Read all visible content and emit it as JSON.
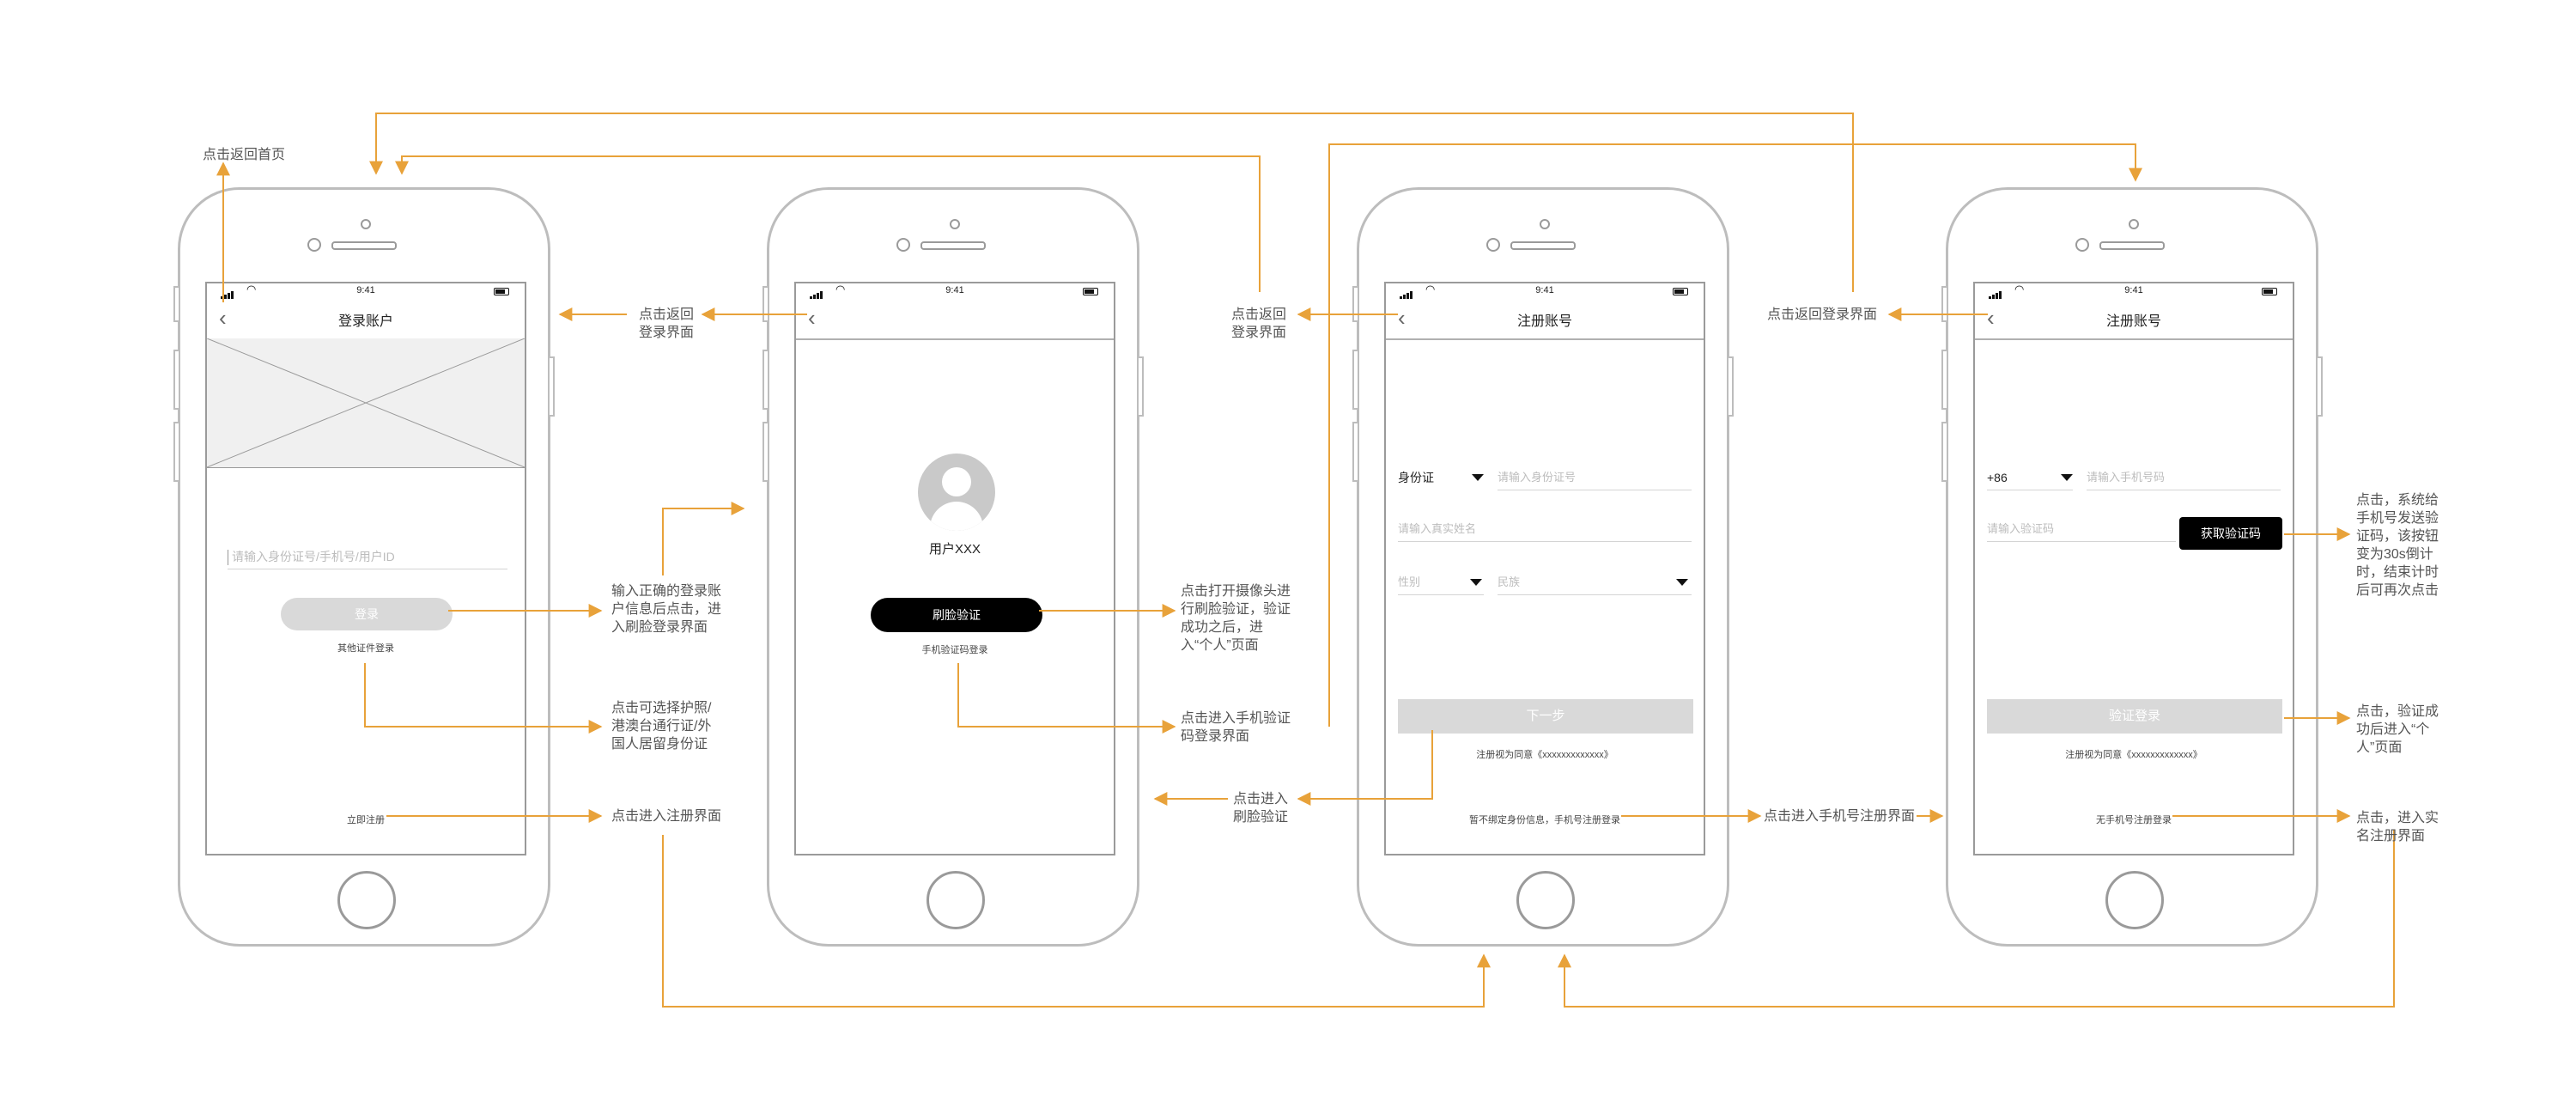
{
  "status_time": "9:41",
  "screens": [
    {
      "title": "登录账户",
      "input_placeholder": "请输入身份证号/手机号/用户ID",
      "login_button": "登录",
      "other_login": "其他证件登录",
      "register_now": "立即注册"
    },
    {
      "username": "用户XXX",
      "face_button": "刷脸验证",
      "sms_login": "手机验证码登录"
    },
    {
      "title": "注册账号",
      "id_type": "身份证",
      "id_placeholder": "请输入身份证号",
      "name_placeholder": "请输入真实姓名",
      "gender_placeholder": "性别",
      "ethnicity_placeholder": "民族",
      "next_button": "下一步",
      "agree_text": "注册视为同意《xxxxxxxxxxxxx》",
      "phone_register_link": "暂不绑定身份信息，手机号注册登录"
    },
    {
      "title": "注册账号",
      "country_code": "+86",
      "phone_placeholder": "请输入手机号码",
      "code_placeholder": "请输入验证码",
      "get_code_button": "获取验证码",
      "verify_login_button": "验证登录",
      "agree_text": "注册视为同意《xxxxxxxxxxxxx》",
      "no_phone_link": "无手机号注册登录"
    }
  ],
  "annotations": {
    "back_home": "点击返回首页",
    "back_login_1": [
      "点击返回",
      "登录界面"
    ],
    "back_login_2": [
      "点击返回",
      "登录界面"
    ],
    "back_login_3": "点击返回登录界面",
    "login_note": [
      "输入正确的登录账",
      "户信息后点击，进",
      "入刷脸登录界面"
    ],
    "other_id_note": [
      "点击可选择护照/",
      "港澳台通行证/外",
      "国人居留身份证"
    ],
    "register_note": "点击进入注册界面",
    "face_note": [
      "点击打开摄像头进",
      "行刷脸验证，验证",
      "成功之后，进",
      "入“个人”页面"
    ],
    "sms_note": [
      "点击进入手机验证",
      "码登录界面"
    ],
    "face_verify_note": [
      "点击进入",
      "刷脸验证"
    ],
    "phone_register_note": "点击进入手机号注册界面",
    "get_code_note": [
      "点击，系统给",
      "手机号发送验",
      "证码，该按钮",
      "变为30s倒计",
      "时，结束计时",
      "后可再次点击"
    ],
    "verify_note": [
      "点击，验证成",
      "功后进入“个",
      "人”页面"
    ],
    "real_name_note": [
      "点击，进入实",
      "名注册界面"
    ]
  },
  "colors": {
    "arrow": "#e8a23a",
    "button_dark": "#000000",
    "button_disabled": "#d9d9d9"
  }
}
